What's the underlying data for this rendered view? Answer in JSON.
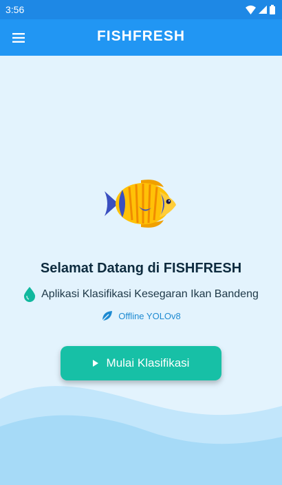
{
  "status_bar": {
    "time": "3:56",
    "icons": [
      "wifi-icon",
      "signal-icon",
      "battery-icon"
    ]
  },
  "app_bar": {
    "title": "FISHFRESH",
    "menu_icon": "menu-icon"
  },
  "main": {
    "illustration": "fish-icon",
    "welcome_title": "Selamat Datang di FISHFRESH",
    "subtitle": "Aplikasi Klasifikasi Kesegaran Ikan Bandeng",
    "subtitle_icon": "water-drop-icon",
    "badge": "Offline YOLOv8",
    "badge_icon": "leaf-icon",
    "start_button": "Mulai Klasifikasi",
    "start_button_icon": "play-icon"
  },
  "colors": {
    "app_bar": "#2196f3",
    "status_bar": "#1e88e5",
    "background": "#e3f3fd",
    "button": "#17c0a6",
    "accent_teal": "#11b89e",
    "badge_text": "#1e8ad1"
  }
}
